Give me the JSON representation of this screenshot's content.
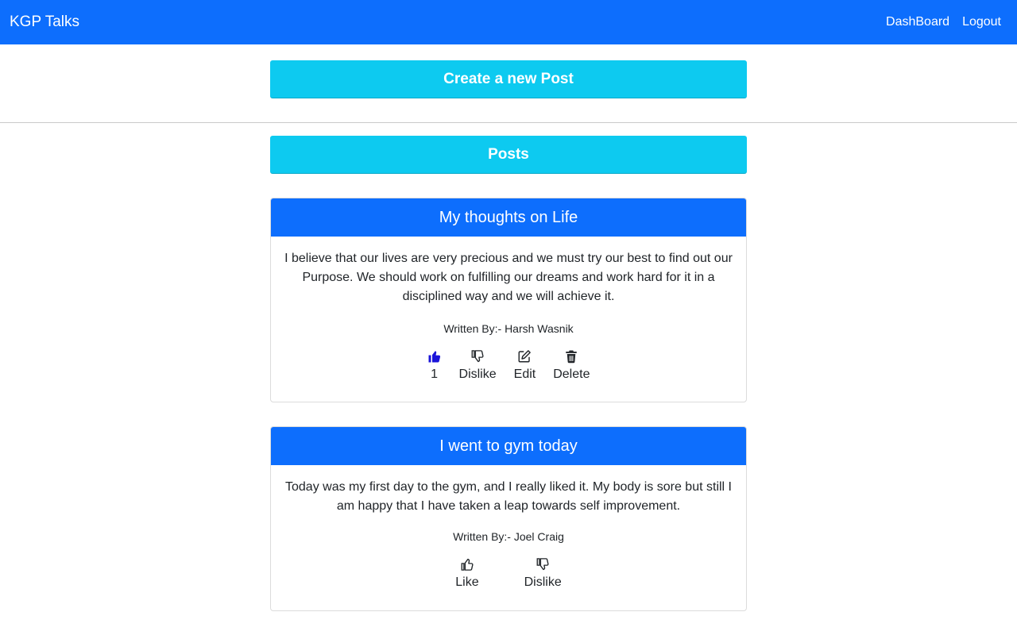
{
  "nav": {
    "brand": "KGP Talks",
    "links": [
      "DashBoard",
      "Logout"
    ]
  },
  "create_button": "Create a new Post",
  "posts_header": "Posts",
  "colors": {
    "primary": "#0d6efd",
    "info": "#0dcaf0",
    "liked": "#1a14d9"
  },
  "posts": [
    {
      "title": "My thoughts on Life",
      "body": "I believe that our lives are very precious and we must try our best to find out our Purpose. We should work on fulfilling our dreams and work hard for it in a disciplined way and we will achieve it.",
      "author": "Written By:- Harsh Wasnik",
      "actions": [
        {
          "icon": "thumbs-up-filled-icon",
          "label": "1"
        },
        {
          "icon": "thumbs-down-outline-icon",
          "label": "Dislike"
        },
        {
          "icon": "edit-icon",
          "label": "Edit"
        },
        {
          "icon": "trash-icon",
          "label": "Delete"
        }
      ]
    },
    {
      "title": "I went to gym today",
      "body": "Today was my first day to the gym, and I really liked it. My body is sore but still I am happy that I have taken a leap towards self improvement.",
      "author": "Written By:- Joel Craig",
      "actions": [
        {
          "icon": "thumbs-up-outline-icon",
          "label": "Like"
        },
        {
          "icon": "thumbs-down-outline-icon",
          "label": "Dislike"
        }
      ]
    }
  ]
}
